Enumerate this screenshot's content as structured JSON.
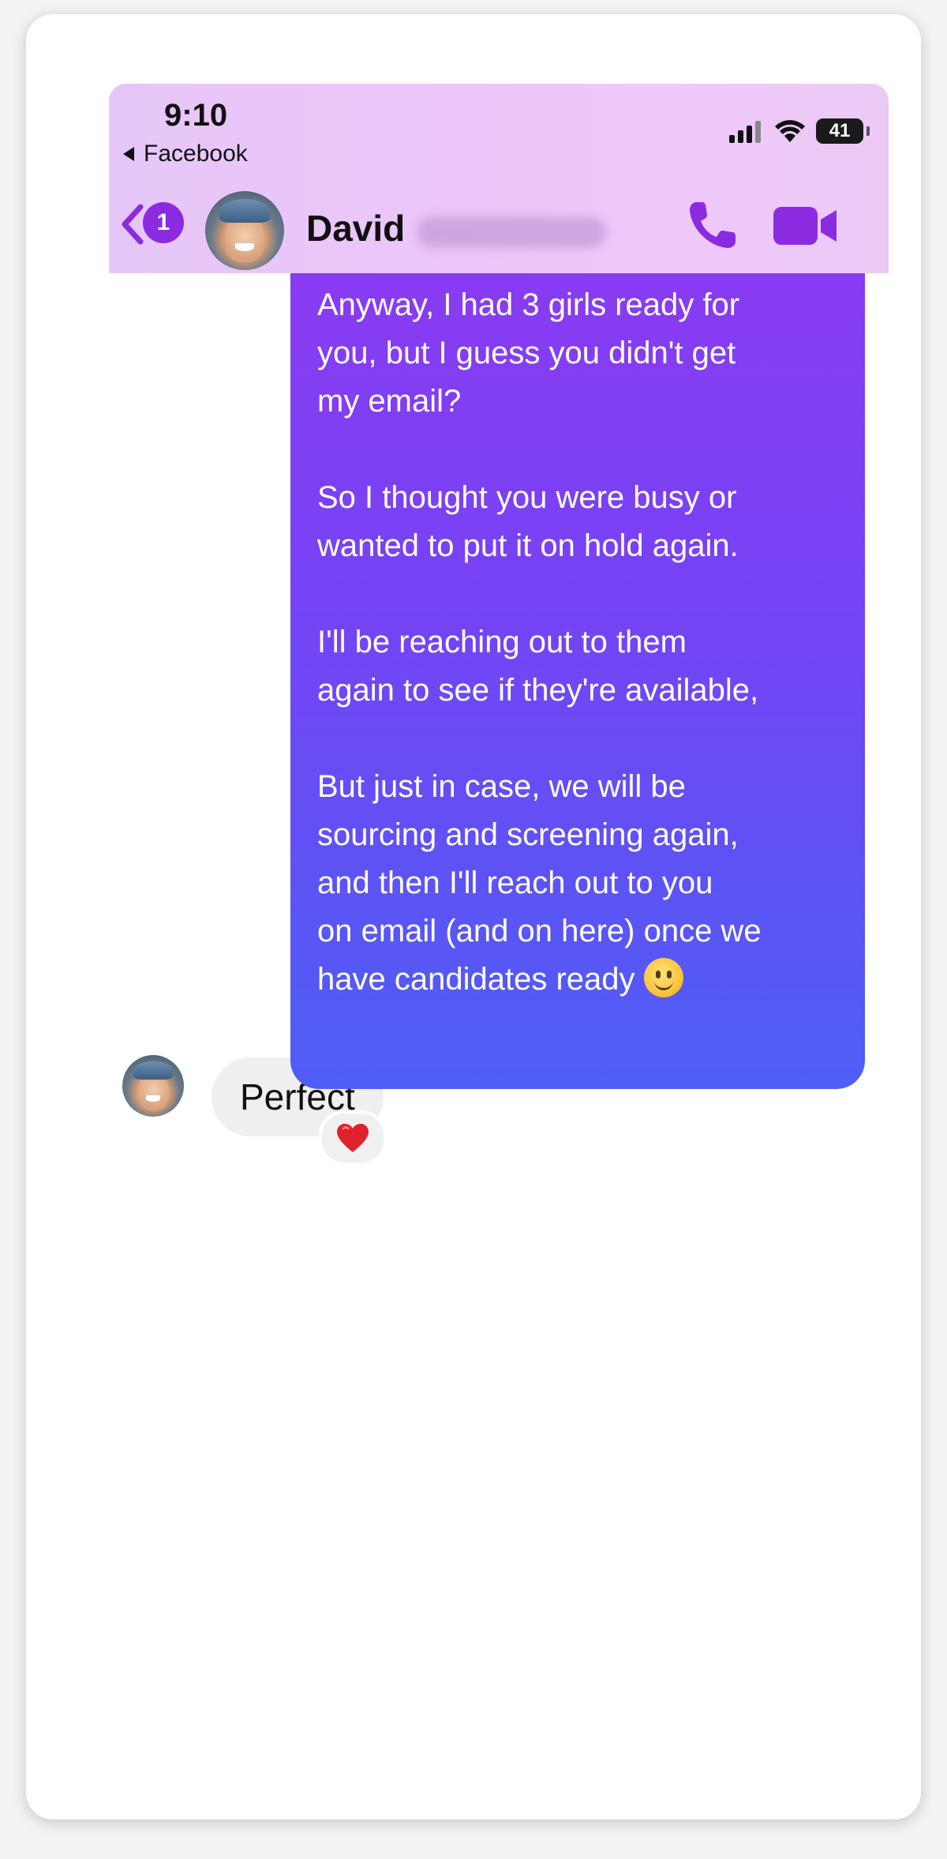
{
  "status_bar": {
    "time": "9:10",
    "back_app_label": "Facebook",
    "battery_level": "41"
  },
  "header": {
    "unread_count": "1",
    "contact_name": "David",
    "icons": [
      "back-chevron-icon",
      "phone-icon",
      "video-camera-icon"
    ]
  },
  "messages": {
    "outgoing": {
      "text": "Anyway, I had 3 girls ready for\nyou, but I guess you didn't get\nmy email?\n\nSo I thought you were busy or\nwanted to put it on hold again.\n\nI'll be reaching out to them\nagain to see if they're available,\n\nBut just in case, we will be\nsourcing and screening again,\nand then I'll reach out to you\non email (and on here) once we\nhave candidates ready",
      "emoji": "slightly-smiling-face"
    },
    "incoming": {
      "text": "Perfect",
      "reaction": "red-heart"
    }
  },
  "colors": {
    "accent": "#8a2be2",
    "bubble_gradient_top": "#8b3af2",
    "bubble_gradient_bottom": "#4e5ef6",
    "header_bg": "#ecc6fa"
  }
}
